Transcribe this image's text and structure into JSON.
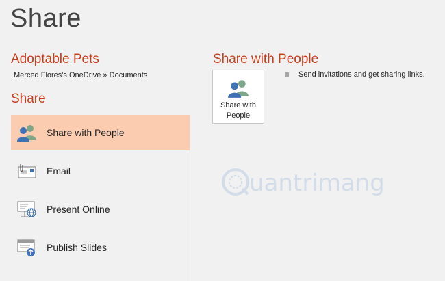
{
  "page": {
    "title": "Share"
  },
  "document": {
    "title": "Adoptable Pets",
    "path": "Merced Flores's OneDrive » Documents"
  },
  "sidebar": {
    "section_title": "Share",
    "items": [
      {
        "label": "Share with People",
        "icon": "people-icon",
        "selected": true
      },
      {
        "label": "Email",
        "icon": "email-icon",
        "selected": false
      },
      {
        "label": "Present Online",
        "icon": "present-online-icon",
        "selected": false
      },
      {
        "label": "Publish Slides",
        "icon": "publish-slides-icon",
        "selected": false
      }
    ]
  },
  "main": {
    "title": "Share with People",
    "card_label": "Share with People",
    "description": "Send invitations and get sharing links."
  },
  "watermark": {
    "text": "uantrimang",
    "icon": "quantrimang-logo-icon"
  },
  "colors": {
    "accent": "#c43e1c",
    "selected_bg": "#fcccb0",
    "background": "#f1f1f1"
  }
}
